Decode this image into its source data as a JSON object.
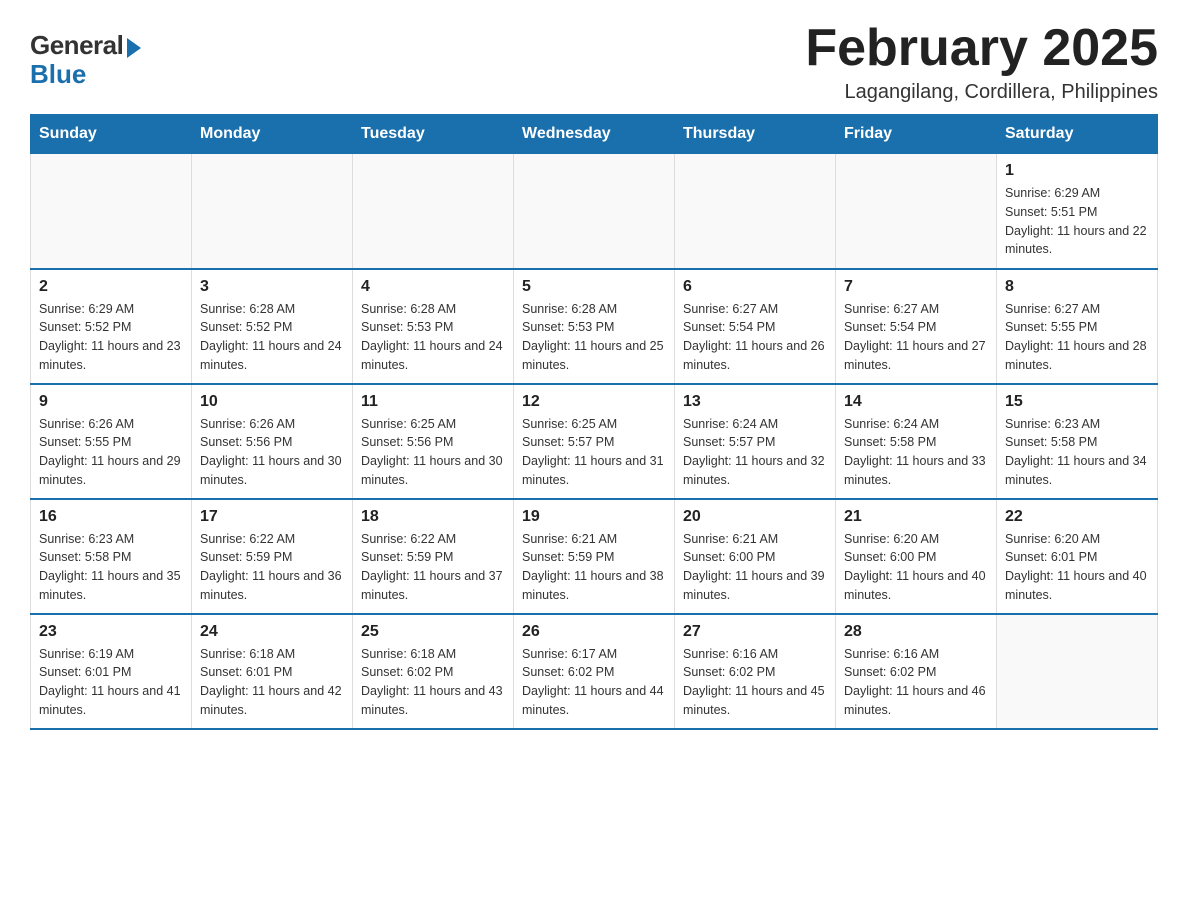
{
  "header": {
    "logo_general": "General",
    "logo_blue": "Blue",
    "title": "February 2025",
    "location": "Lagangilang, Cordillera, Philippines"
  },
  "days_of_week": [
    "Sunday",
    "Monday",
    "Tuesday",
    "Wednesday",
    "Thursday",
    "Friday",
    "Saturday"
  ],
  "weeks": [
    {
      "days": [
        {
          "number": "",
          "info": ""
        },
        {
          "number": "",
          "info": ""
        },
        {
          "number": "",
          "info": ""
        },
        {
          "number": "",
          "info": ""
        },
        {
          "number": "",
          "info": ""
        },
        {
          "number": "",
          "info": ""
        },
        {
          "number": "1",
          "info": "Sunrise: 6:29 AM\nSunset: 5:51 PM\nDaylight: 11 hours and 22 minutes."
        }
      ]
    },
    {
      "days": [
        {
          "number": "2",
          "info": "Sunrise: 6:29 AM\nSunset: 5:52 PM\nDaylight: 11 hours and 23 minutes."
        },
        {
          "number": "3",
          "info": "Sunrise: 6:28 AM\nSunset: 5:52 PM\nDaylight: 11 hours and 24 minutes."
        },
        {
          "number": "4",
          "info": "Sunrise: 6:28 AM\nSunset: 5:53 PM\nDaylight: 11 hours and 24 minutes."
        },
        {
          "number": "5",
          "info": "Sunrise: 6:28 AM\nSunset: 5:53 PM\nDaylight: 11 hours and 25 minutes."
        },
        {
          "number": "6",
          "info": "Sunrise: 6:27 AM\nSunset: 5:54 PM\nDaylight: 11 hours and 26 minutes."
        },
        {
          "number": "7",
          "info": "Sunrise: 6:27 AM\nSunset: 5:54 PM\nDaylight: 11 hours and 27 minutes."
        },
        {
          "number": "8",
          "info": "Sunrise: 6:27 AM\nSunset: 5:55 PM\nDaylight: 11 hours and 28 minutes."
        }
      ]
    },
    {
      "days": [
        {
          "number": "9",
          "info": "Sunrise: 6:26 AM\nSunset: 5:55 PM\nDaylight: 11 hours and 29 minutes."
        },
        {
          "number": "10",
          "info": "Sunrise: 6:26 AM\nSunset: 5:56 PM\nDaylight: 11 hours and 30 minutes."
        },
        {
          "number": "11",
          "info": "Sunrise: 6:25 AM\nSunset: 5:56 PM\nDaylight: 11 hours and 30 minutes."
        },
        {
          "number": "12",
          "info": "Sunrise: 6:25 AM\nSunset: 5:57 PM\nDaylight: 11 hours and 31 minutes."
        },
        {
          "number": "13",
          "info": "Sunrise: 6:24 AM\nSunset: 5:57 PM\nDaylight: 11 hours and 32 minutes."
        },
        {
          "number": "14",
          "info": "Sunrise: 6:24 AM\nSunset: 5:58 PM\nDaylight: 11 hours and 33 minutes."
        },
        {
          "number": "15",
          "info": "Sunrise: 6:23 AM\nSunset: 5:58 PM\nDaylight: 11 hours and 34 minutes."
        }
      ]
    },
    {
      "days": [
        {
          "number": "16",
          "info": "Sunrise: 6:23 AM\nSunset: 5:58 PM\nDaylight: 11 hours and 35 minutes."
        },
        {
          "number": "17",
          "info": "Sunrise: 6:22 AM\nSunset: 5:59 PM\nDaylight: 11 hours and 36 minutes."
        },
        {
          "number": "18",
          "info": "Sunrise: 6:22 AM\nSunset: 5:59 PM\nDaylight: 11 hours and 37 minutes."
        },
        {
          "number": "19",
          "info": "Sunrise: 6:21 AM\nSunset: 5:59 PM\nDaylight: 11 hours and 38 minutes."
        },
        {
          "number": "20",
          "info": "Sunrise: 6:21 AM\nSunset: 6:00 PM\nDaylight: 11 hours and 39 minutes."
        },
        {
          "number": "21",
          "info": "Sunrise: 6:20 AM\nSunset: 6:00 PM\nDaylight: 11 hours and 40 minutes."
        },
        {
          "number": "22",
          "info": "Sunrise: 6:20 AM\nSunset: 6:01 PM\nDaylight: 11 hours and 40 minutes."
        }
      ]
    },
    {
      "days": [
        {
          "number": "23",
          "info": "Sunrise: 6:19 AM\nSunset: 6:01 PM\nDaylight: 11 hours and 41 minutes."
        },
        {
          "number": "24",
          "info": "Sunrise: 6:18 AM\nSunset: 6:01 PM\nDaylight: 11 hours and 42 minutes."
        },
        {
          "number": "25",
          "info": "Sunrise: 6:18 AM\nSunset: 6:02 PM\nDaylight: 11 hours and 43 minutes."
        },
        {
          "number": "26",
          "info": "Sunrise: 6:17 AM\nSunset: 6:02 PM\nDaylight: 11 hours and 44 minutes."
        },
        {
          "number": "27",
          "info": "Sunrise: 6:16 AM\nSunset: 6:02 PM\nDaylight: 11 hours and 45 minutes."
        },
        {
          "number": "28",
          "info": "Sunrise: 6:16 AM\nSunset: 6:02 PM\nDaylight: 11 hours and 46 minutes."
        },
        {
          "number": "",
          "info": ""
        }
      ]
    }
  ]
}
